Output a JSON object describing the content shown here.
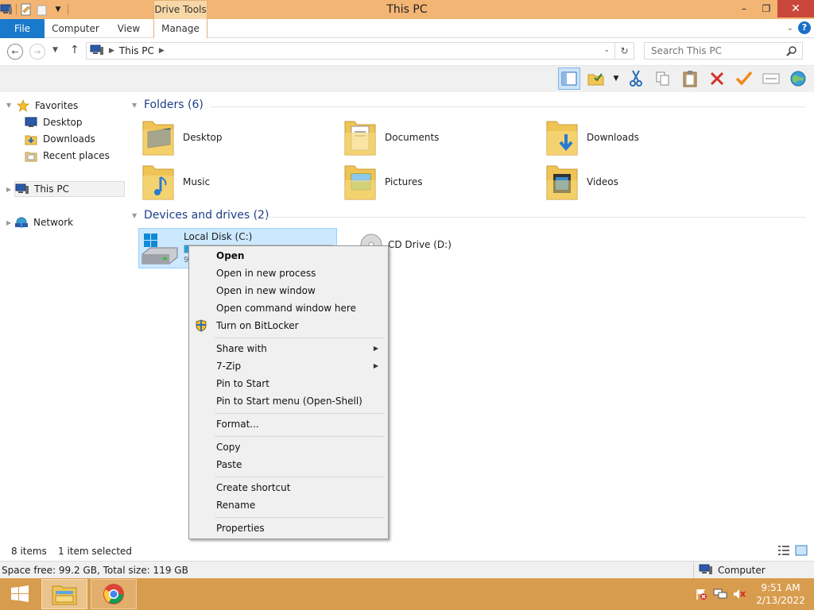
{
  "window": {
    "title": "This PC",
    "contextual_tab_group": "Drive Tools",
    "controls": {
      "minimize": "–",
      "maximize": "❐",
      "close": "✕"
    }
  },
  "ribbon": {
    "tabs": [
      {
        "label": "File"
      },
      {
        "label": "Computer"
      },
      {
        "label": "View"
      },
      {
        "label": "Manage"
      }
    ],
    "help": "?"
  },
  "address": {
    "crumb": "This PC",
    "search_placeholder": "Search This PC"
  },
  "nav": {
    "favorites": "Favorites",
    "desktop": "Desktop",
    "downloads": "Downloads",
    "recent": "Recent places",
    "this_pc": "This PC",
    "network": "Network"
  },
  "content": {
    "folders_title": "Folders (6)",
    "folders": [
      {
        "label": "Desktop",
        "icon": "desktop-folder-icon"
      },
      {
        "label": "Documents",
        "icon": "documents-folder-icon"
      },
      {
        "label": "Downloads",
        "icon": "downloads-folder-icon"
      },
      {
        "label": "Music",
        "icon": "music-folder-icon"
      },
      {
        "label": "Pictures",
        "icon": "pictures-folder-icon"
      },
      {
        "label": "Videos",
        "icon": "videos-folder-icon"
      }
    ],
    "devices_title": "Devices and drives (2)",
    "local_disk": {
      "label": "Local Disk (C:)",
      "used_fraction": 0.17,
      "free_text": "9"
    },
    "cd_drive": {
      "label": "CD Drive (D:)"
    }
  },
  "context_menu": {
    "items": [
      {
        "label": "Open"
      },
      {
        "label": "Open in new process"
      },
      {
        "label": "Open in new window"
      },
      {
        "label": "Open command window here"
      },
      {
        "label": "Turn on BitLocker"
      },
      {
        "label": "Share with"
      },
      {
        "label": "7-Zip"
      },
      {
        "label": "Pin to Start"
      },
      {
        "label": "Pin to Start menu (Open-Shell)"
      },
      {
        "label": "Format..."
      },
      {
        "label": "Copy"
      },
      {
        "label": "Paste"
      },
      {
        "label": "Create shortcut"
      },
      {
        "label": "Rename"
      },
      {
        "label": "Properties"
      }
    ],
    "submenu_arrow": "▶"
  },
  "status": {
    "items": "8 items",
    "selected": "1 item selected"
  },
  "details": {
    "space": "Space free: 99.2 GB, Total size: 119 GB",
    "location": "Computer"
  },
  "taskbar": {
    "time": "9:51 AM",
    "date": "2/13/2022"
  },
  "colors": {
    "title_bar": "#f3b574",
    "file_tab": "#1979ca",
    "taskbar": "#d89c4e",
    "selection": "#cce8ff",
    "group_heading": "#1e3e87"
  }
}
